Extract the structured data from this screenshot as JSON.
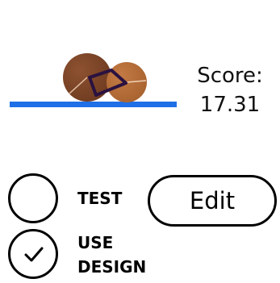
{
  "score": {
    "label": "Score:",
    "value": "17.31"
  },
  "options": [
    {
      "label_lines": [
        "TEST"
      ],
      "checked": false
    },
    {
      "label_lines": [
        "USE",
        "DESIGN"
      ],
      "checked": true
    }
  ],
  "edit_button": {
    "label": "Edit"
  },
  "colors": {
    "ground": "#1f6fe6",
    "wheel_dark": "#7a4426",
    "wheel_light": "#b9713f",
    "frame": "#2a1240"
  },
  "icons": {
    "check": "check-icon"
  }
}
